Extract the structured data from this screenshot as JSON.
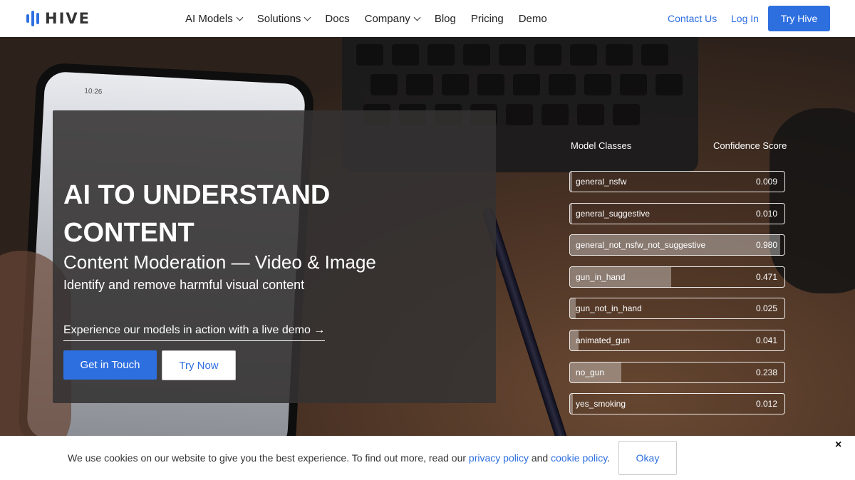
{
  "header": {
    "logo_text": "HIVE",
    "nav": [
      {
        "label": "AI Models",
        "dropdown": true
      },
      {
        "label": "Solutions",
        "dropdown": true
      },
      {
        "label": "Docs",
        "dropdown": false
      },
      {
        "label": "Company",
        "dropdown": true
      },
      {
        "label": "Blog",
        "dropdown": false
      },
      {
        "label": "Pricing",
        "dropdown": false
      },
      {
        "label": "Demo",
        "dropdown": false
      }
    ],
    "contact_label": "Contact Us",
    "login_label": "Log In",
    "try_label": "Try Hive"
  },
  "hero": {
    "phone_time": "10:26",
    "title": "AI TO UNDERSTAND CONTENT",
    "subtitle": "Content Moderation — Video & Image",
    "description": "Identify and remove harmful visual content",
    "demo_link": "Experience our models in action with a live demo →",
    "get_in_touch_label": "Get in Touch",
    "try_now_label": "Try Now"
  },
  "model_panel": {
    "classes_header": "Model Classes",
    "score_header": "Confidence Score",
    "classes": [
      {
        "name": "general_nsfw",
        "score": "0.009"
      },
      {
        "name": "general_suggestive",
        "score": "0.010"
      },
      {
        "name": "general_not_nsfw_not_suggestive",
        "score": "0.980"
      },
      {
        "name": "gun_in_hand",
        "score": "0.471"
      },
      {
        "name": "gun_not_in_hand",
        "score": "0.025"
      },
      {
        "name": "animated_gun",
        "score": "0.041"
      },
      {
        "name": "no_gun",
        "score": "0.238"
      },
      {
        "name": "yes_smoking",
        "score": "0.012"
      }
    ]
  },
  "cookie": {
    "text_before": "We use cookies on our website to give you the best experience. To find out more, read our ",
    "privacy_link": "privacy policy",
    "text_and": " and ",
    "cookie_link": "cookie policy",
    "text_after": ".",
    "okay_label": "Okay",
    "close_symbol": "×"
  },
  "colors": {
    "accent": "#2e6fe0",
    "panel": "#343232"
  },
  "icons": [
    "hive-logo-icon",
    "chevron-down-icon",
    "close-icon"
  ]
}
